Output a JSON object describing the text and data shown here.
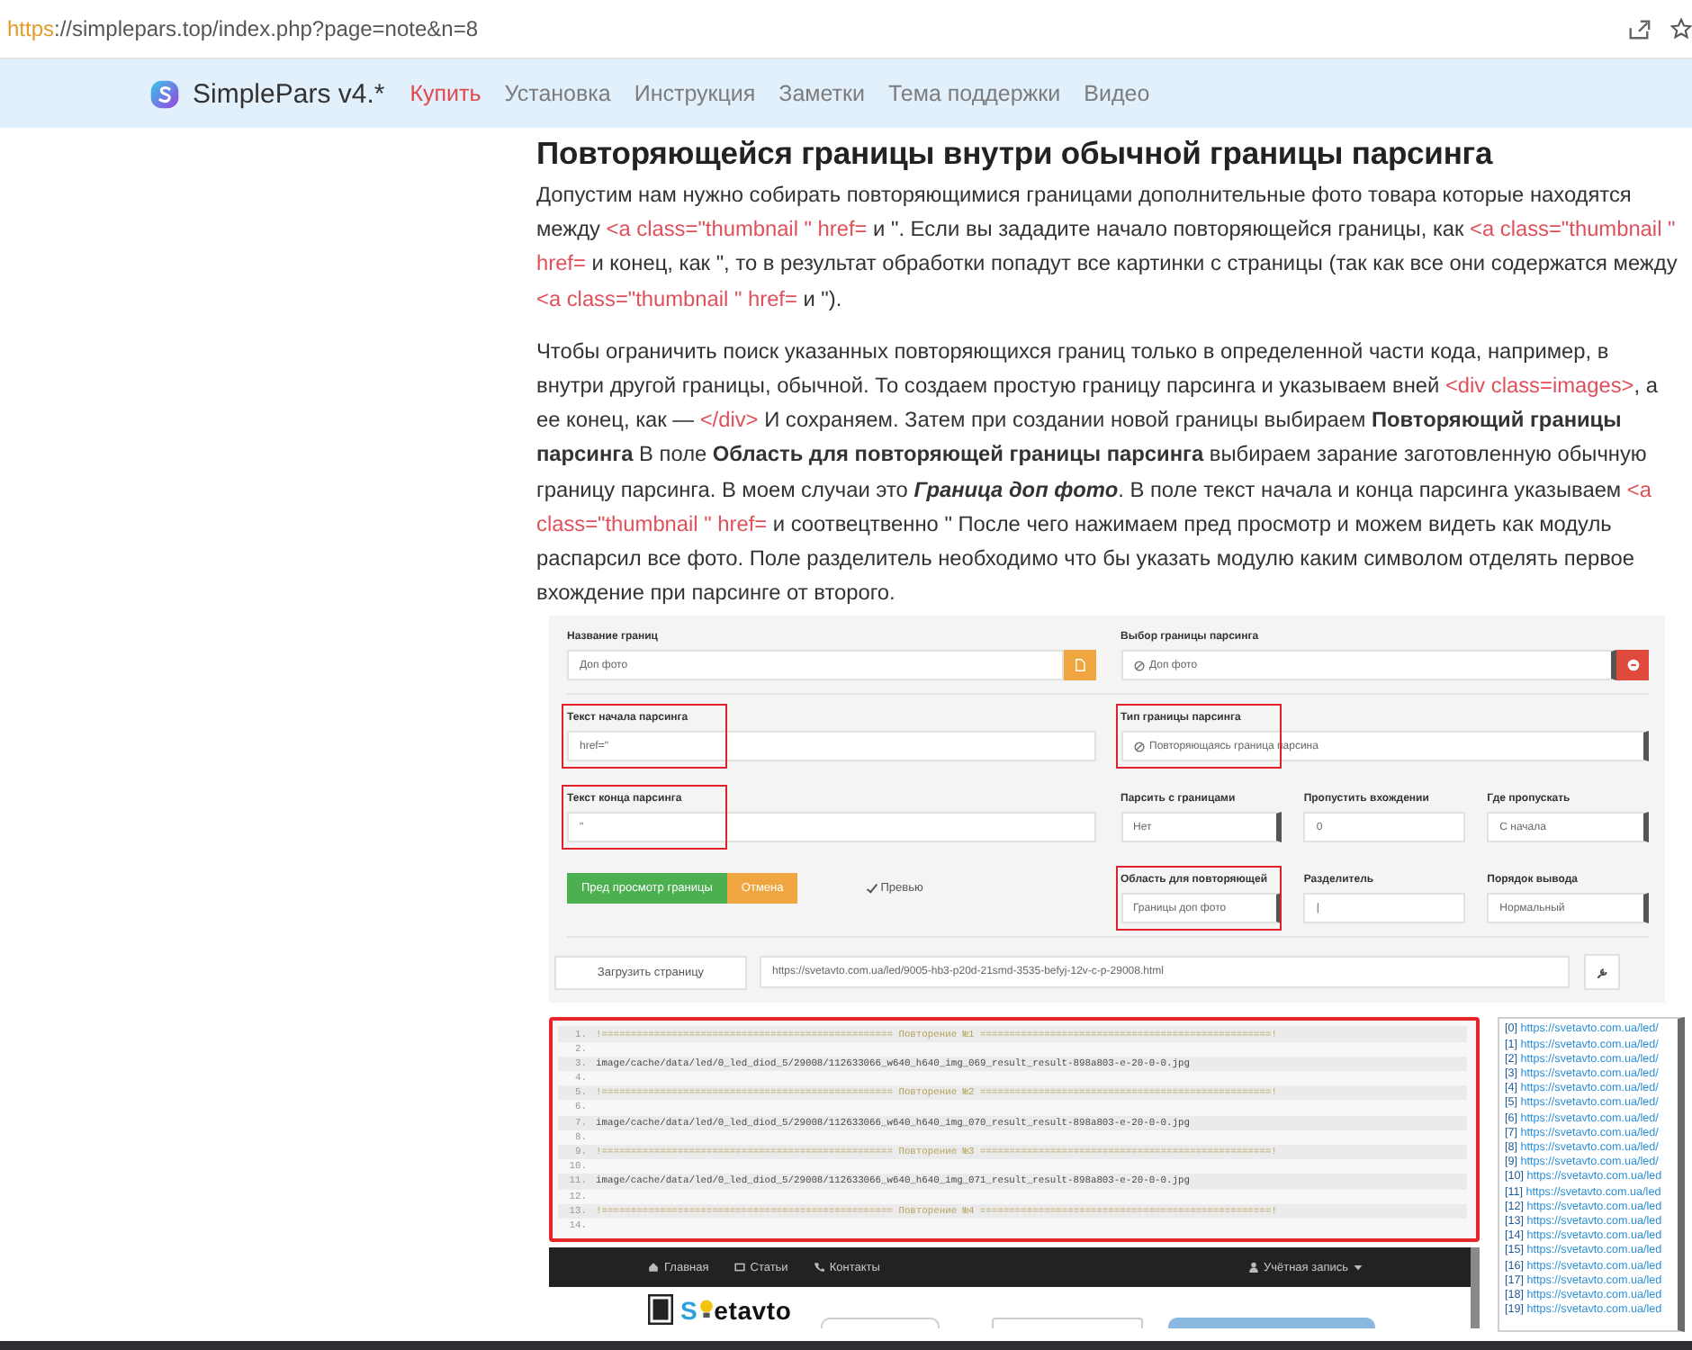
{
  "browser": {
    "url_scheme": "https",
    "url_rest": "://simplepars.top/index.php?page=note&n=8"
  },
  "site_nav": {
    "brand": "SimplePars v4.*",
    "links": [
      {
        "label": "Купить",
        "selected": true
      },
      {
        "label": "Установка",
        "selected": false
      },
      {
        "label": "Инструкция",
        "selected": false
      },
      {
        "label": "Заметки",
        "selected": false
      },
      {
        "label": "Тема поддержки",
        "selected": false
      },
      {
        "label": "Видео",
        "selected": false
      }
    ]
  },
  "article": {
    "heading": "Повторяющейся границы внутри обычной границы парсинга",
    "paragraphs": [
      {
        "segments": [
          {
            "kind": "text",
            "text": "Допустим нам нужно собирать повторяющимися границами дополнительные фото товара которые находятся между "
          },
          {
            "kind": "code",
            "text": "<a class=\"thumbnail \" href="
          },
          {
            "kind": "text",
            "text": " и \". Если вы зададите начало повторяющейся границы, как "
          },
          {
            "kind": "code",
            "text": "<a class=\"thumbnail \" href="
          },
          {
            "kind": "text",
            "text": " и конец, как \", то в результат обработки попадут все картинки с страницы (так как все они содержатся между "
          },
          {
            "kind": "code",
            "text": "<a class=\"thumbnail \" href="
          },
          {
            "kind": "text",
            "text": " и \")."
          }
        ]
      },
      {
        "segments": [
          {
            "kind": "text",
            "text": "Чтобы ограничить поиск указанных повторяющихся границ только в определенной части кода, например, в внутри другой границы, обычной. То создаем простую границу парсинга и указываем вней "
          },
          {
            "kind": "code",
            "text": "<div class=images>"
          },
          {
            "kind": "text",
            "text": ", а ее конец, как — "
          },
          {
            "kind": "code",
            "text": "</div>"
          },
          {
            "kind": "text",
            "text": " И сохраняем. Затем при создании новой границы выбираем **Повторяющий границы парсинга** В поле **Область для повторяющей границы парсинга** выбираем зарание заготовленную обычную границу парсинга. В моем случаи это "
          },
          {
            "kind": "emphasis",
            "text": "Граница доп фото"
          },
          {
            "kind": "text",
            "text": ". В поле текст начала и конца парсинга указываем "
          },
          {
            "kind": "code",
            "text": "<a class=\"thumbnail \" href="
          },
          {
            "kind": "text",
            "text": " и соотвецтвенно \" После чего нажимаем пред просмотр и можем видеть как модуль распарсил все фото. Поле разделитель необходимо что бы указать модулю каким символом отделять первое вхождение при парсинге от второго."
          }
        ]
      }
    ]
  },
  "preview_form": {
    "rows": [
      {
        "divider": true,
        "left": [
          {
            "kind": "input",
            "label": "Название границ",
            "value": "Доп фото",
            "highlighted": false,
            "addon": true
          }
        ],
        "right": [
          {
            "kind": "select",
            "label": "Выбор границы парсинга",
            "value": "Доп фото",
            "icon": true,
            "highlighted": false,
            "addon": true
          }
        ]
      },
      {
        "divider": false,
        "left": [
          {
            "kind": "input",
            "label": "Текст начала парсинга",
            "value": "href=\"",
            "highlighted": true
          }
        ],
        "right": [
          {
            "kind": "select",
            "label": "Тип границы парсинга",
            "value": "Повторяющаясь граница парсина",
            "icon": true,
            "highlighted": true
          }
        ]
      },
      {
        "divider": false,
        "left": [
          {
            "kind": "input",
            "label": "Текст конца парсинга",
            "value": "\"",
            "highlighted": true
          }
        ],
        "right": [
          {
            "kind": "select",
            "label": "Парсить с границами",
            "value": "Нет",
            "highlighted": false
          },
          {
            "kind": "input",
            "label": "Пропустить вхождении",
            "value": "0",
            "highlighted": false
          },
          {
            "kind": "select",
            "label": "Где пропускать",
            "value": "С начала",
            "highlighted": false
          }
        ]
      },
      {
        "divider": true,
        "left": [
          {
            "kind": "button",
            "label": "Пред просмотр границы"
          },
          {
            "kind": "button",
            "label": "Отмена"
          },
          {
            "kind": "checkbox",
            "label": "Превью",
            "checked": true
          }
        ],
        "right": [
          {
            "kind": "select",
            "label": "Область для повторяющей",
            "value": "Границы доп фото",
            "highlighted": true
          },
          {
            "kind": "input",
            "label": "Разделитель",
            "value": "|",
            "highlighted": false
          },
          {
            "kind": "select",
            "label": "Порядок вывода",
            "value": "Нормальный",
            "highlighted": false
          }
        ]
      }
    ],
    "toolbar": [
      {
        "kind": "button",
        "label": "Загрузить страницу"
      },
      {
        "kind": "input",
        "value": "https://svetavto.com.ua/led/9005-hb3-p20d-21smd-3535-befyj-12v-c-p-29008.html"
      },
      {
        "kind": "icon_button"
      }
    ]
  },
  "code_preview": {
    "lines": [
      {
        "number": "1.",
        "kind": "separator",
        "text": "!================================================== Повторение №1 ==================================================!"
      },
      {
        "number": "2.",
        "kind": "empty"
      },
      {
        "number": "3.",
        "kind": "path",
        "text": "image/cache/data/led/0_led_diod_5/29008/112633066_w640_h640_img_069_result_result-898a803-e-20-0-0.jpg"
      },
      {
        "number": "4.",
        "kind": "empty"
      },
      {
        "number": "5.",
        "kind": "separator",
        "text": "!================================================== Повторение №2 ==================================================!"
      },
      {
        "number": "6.",
        "kind": "empty"
      },
      {
        "number": "7.",
        "kind": "path",
        "text": "image/cache/data/led/0_led_diod_5/29008/112633066_w640_h640_img_070_result_result-898a803-e-20-0-0.jpg"
      },
      {
        "number": "8.",
        "kind": "empty"
      },
      {
        "number": "9.",
        "kind": "separator",
        "text": "!================================================== Повторение №3 ==================================================!"
      },
      {
        "number": "10.",
        "kind": "empty"
      },
      {
        "number": "11.",
        "kind": "path",
        "text": "image/cache/data/led/0_led_diod_5/29008/112633066_w640_h640_img_071_result_result-898a803-e-20-0-0.jpg"
      },
      {
        "number": "12.",
        "kind": "empty"
      },
      {
        "number": "13.",
        "kind": "separator",
        "text": "!================================================== Повторение №4 ==================================================!"
      },
      {
        "number": "14.",
        "kind": "empty"
      }
    ]
  },
  "url_list": [
    {
      "index": "[0]",
      "url": "https://svetavto.com.ua/led/"
    },
    {
      "index": "[1]",
      "url": "https://svetavto.com.ua/led/"
    },
    {
      "index": "[2]",
      "url": "https://svetavto.com.ua/led/"
    },
    {
      "index": "[3]",
      "url": "https://svetavto.com.ua/led/"
    },
    {
      "index": "[4]",
      "url": "https://svetavto.com.ua/led/"
    },
    {
      "index": "[5]",
      "url": "https://svetavto.com.ua/led/"
    },
    {
      "index": "[6]",
      "url": "https://svetavto.com.ua/led/"
    },
    {
      "index": "[7]",
      "url": "https://svetavto.com.ua/led/"
    },
    {
      "index": "[8]",
      "url": "https://svetavto.com.ua/led/"
    },
    {
      "index": "[9]",
      "url": "https://svetavto.com.ua/led/"
    },
    {
      "index": "[10]",
      "url": "https://svetavto.com.ua/led"
    },
    {
      "index": "[11]",
      "url": "https://svetavto.com.ua/led"
    },
    {
      "index": "[12]",
      "url": "https://svetavto.com.ua/led"
    },
    {
      "index": "[13]",
      "url": "https://svetavto.com.ua/led"
    },
    {
      "index": "[14]",
      "url": "https://svetavto.com.ua/led"
    },
    {
      "index": "[15]",
      "url": "https://svetavto.com.ua/led"
    },
    {
      "index": "[16]",
      "url": "https://svetavto.com.ua/led"
    },
    {
      "index": "[17]",
      "url": "https://svetavto.com.ua/led"
    },
    {
      "index": "[18]",
      "url": "https://svetavto.com.ua/led"
    },
    {
      "index": "[19]",
      "url": "https://svetavto.com.ua/led"
    }
  ],
  "site_preview": {
    "nav": [
      "Главная",
      "Статьи",
      "Контакты"
    ],
    "account": "Учётная запись",
    "brand": [
      "S",
      "etavto"
    ]
  }
}
